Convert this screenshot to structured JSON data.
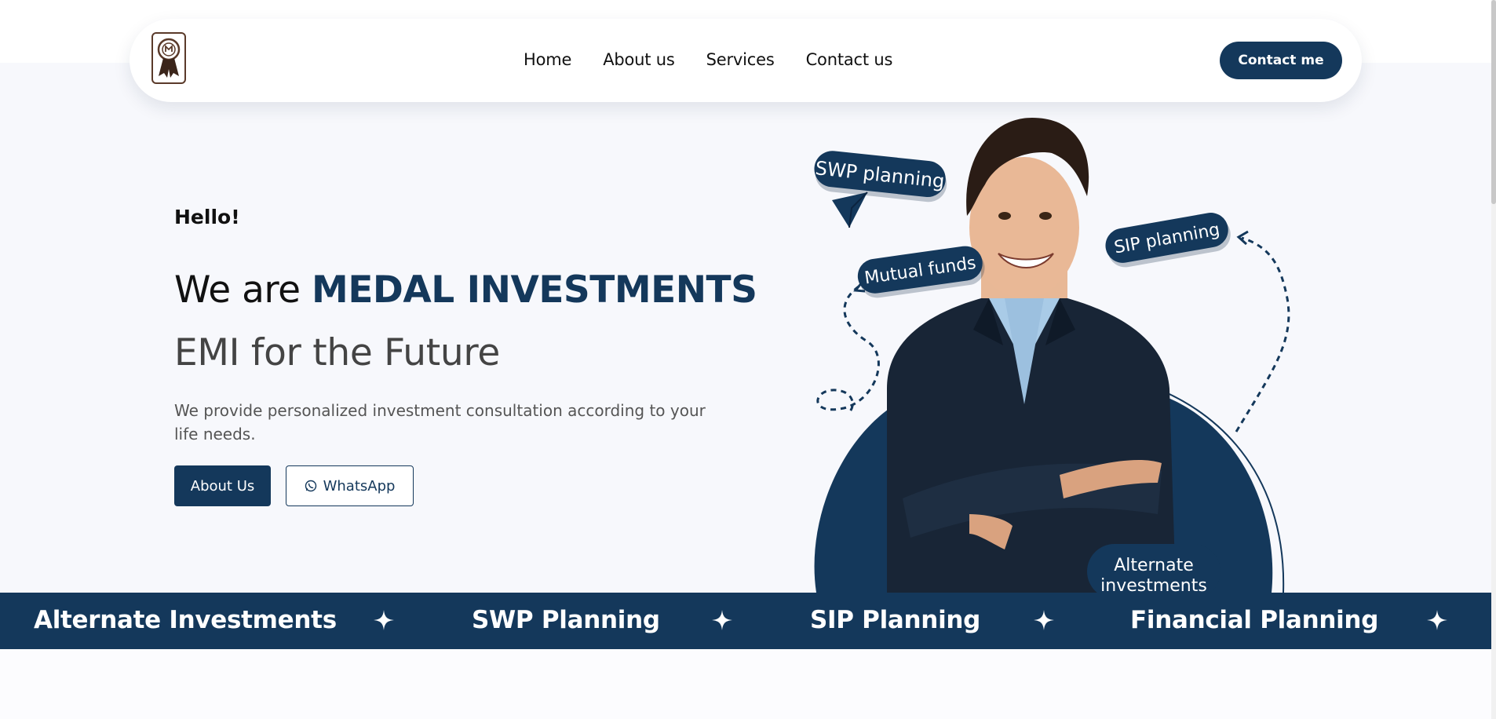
{
  "nav": {
    "links": [
      "Home",
      "About us",
      "Services",
      "Contact us"
    ],
    "contact_button": "Contact me"
  },
  "hero": {
    "greeting": "Hello!",
    "headline_prefix": "We are",
    "headline_brand": "MEDAL INVESTMENTS",
    "subheadline": "EMI for the Future",
    "description": "We provide personalized investment consultation according to your life needs.",
    "about_button": "About Us",
    "whatsapp_button": "WhatsApp",
    "tags": {
      "swp": "SWP planning",
      "mutual_funds": "Mutual funds",
      "sip": "SIP planning",
      "alternate_line1": "Alternate",
      "alternate_line2": "investments"
    }
  },
  "marquee": {
    "items": [
      "Alternate Investments",
      "SWP Planning",
      "SIP Planning",
      "Financial Planning"
    ]
  },
  "colors": {
    "primary": "#14385b",
    "hero_background": "#f7f8fc"
  },
  "icons": {
    "logo": "medal-logo-icon",
    "whatsapp": "whatsapp-icon",
    "separator": "four-point-star-icon"
  }
}
